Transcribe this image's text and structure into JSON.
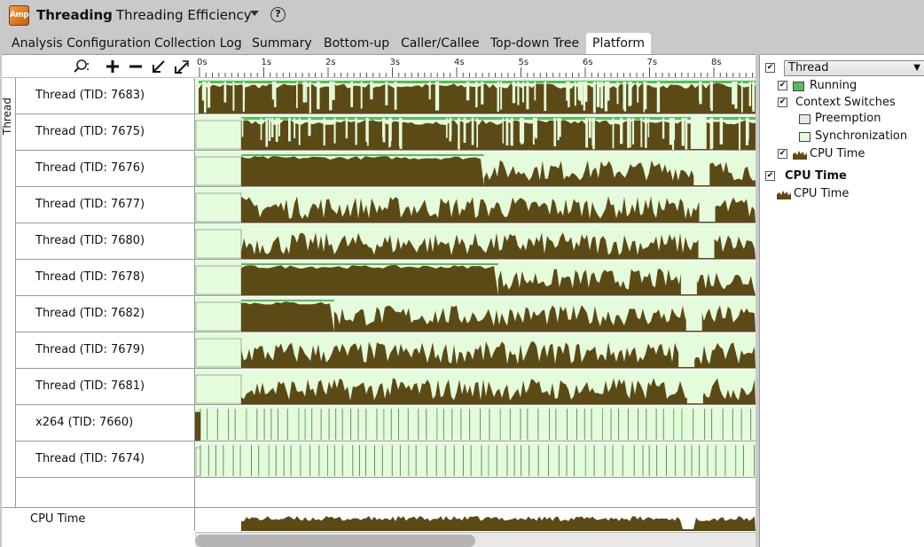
{
  "app": {
    "name": "Threading",
    "logo_text": "Amp",
    "analysis": "Threading Efficiency",
    "help": "?"
  },
  "tabs": [
    {
      "label": "Analysis Configuration"
    },
    {
      "label": "Collection Log"
    },
    {
      "label": "Summary"
    },
    {
      "label": "Bottom-up"
    },
    {
      "label": "Caller/Callee"
    },
    {
      "label": "Top-down Tree"
    },
    {
      "label": "Platform",
      "active": true
    }
  ],
  "toolbar": {
    "icons": [
      "search-icon",
      "zoom-in-icon",
      "zoom-out-icon",
      "zoom-to-selection-icon",
      "undo-zoom-icon"
    ]
  },
  "timeline": {
    "ticks": [
      "0s",
      "1s",
      "2s",
      "3s",
      "4s",
      "5s",
      "6s",
      "7s",
      "8s"
    ],
    "group_label": "Thread",
    "rows": [
      {
        "label": "Thread (TID: 7683)",
        "pattern": "dense"
      },
      {
        "label": "Thread (TID: 7675)",
        "pattern": "dense"
      },
      {
        "label": "Thread (TID: 7676)",
        "pattern": "mixed"
      },
      {
        "label": "Thread (TID: 7677)",
        "pattern": "spiky"
      },
      {
        "label": "Thread (TID: 7680)",
        "pattern": "spiky"
      },
      {
        "label": "Thread (TID: 7678)",
        "pattern": "mixed"
      },
      {
        "label": "Thread (TID: 7682)",
        "pattern": "mixed"
      },
      {
        "label": "Thread (TID: 7679)",
        "pattern": "spiky"
      },
      {
        "label": "Thread (TID: 7681)",
        "pattern": "spiky"
      },
      {
        "label": "x264 (TID: 7660)",
        "pattern": "sync"
      },
      {
        "label": "Thread (TID: 7674)",
        "pattern": "sync"
      }
    ],
    "cpu_label": "CPU Time"
  },
  "legend": {
    "thread_select": "Thread",
    "running": "Running",
    "context_switches": "Context Switches",
    "preemption": "Preemption",
    "synchronization": "Synchronization",
    "cpu_time": "CPU Time",
    "cpu_group": "CPU Time",
    "cpu_group_item": "CPU Time"
  },
  "colors": {
    "running": "#5cb85c",
    "cpu_time": "#5c4a16",
    "synchronization": "#e4fbdc",
    "preemption": "#e8e8e8",
    "accent": "#c55e15"
  }
}
